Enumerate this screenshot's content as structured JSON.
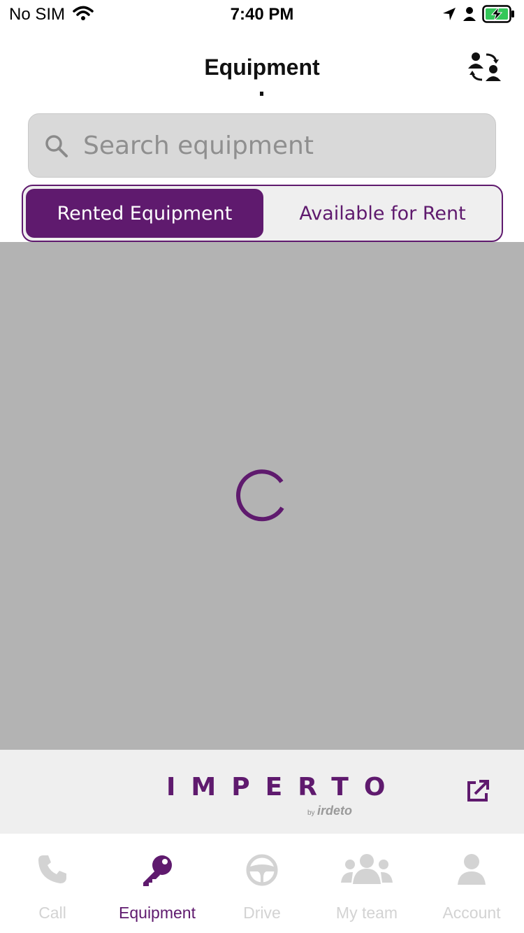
{
  "status_bar": {
    "carrier": "No SIM",
    "time": "7:40 PM"
  },
  "header": {
    "title": "Equipment",
    "switch_icon": "switch-user-icon"
  },
  "search": {
    "placeholder": "Search equipment",
    "value": ""
  },
  "segment": {
    "options": [
      "Rented Equipment",
      "Available for Rent"
    ],
    "selected": "Rented Equipment"
  },
  "loading": {
    "visible": true
  },
  "branding": {
    "logo_text": "IMPERTO",
    "logo_by": "by",
    "logo_sub": "irdeto",
    "link_icon": "external-link-icon"
  },
  "tab_bar": {
    "tabs": [
      {
        "label": "Call",
        "icon": "phone-icon",
        "active": false
      },
      {
        "label": "Equipment",
        "icon": "key-icon",
        "active": true
      },
      {
        "label": "Drive",
        "icon": "steering-wheel-icon",
        "active": false
      },
      {
        "label": "My team",
        "icon": "team-icon",
        "active": false
      },
      {
        "label": "Account",
        "icon": "account-icon",
        "active": false
      }
    ]
  },
  "colors": {
    "brand_purple": "#5f1a6e",
    "overlay_gray": "#b3b3b3",
    "inactive_tab": "#d3d3d3",
    "battery_green": "#34c759"
  }
}
